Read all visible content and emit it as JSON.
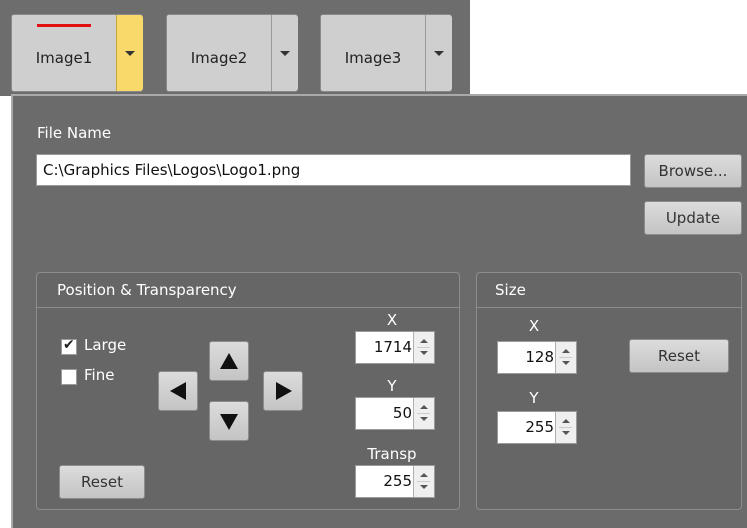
{
  "tabs": [
    {
      "label": "Image1",
      "active": true
    },
    {
      "label": "Image2",
      "active": false
    },
    {
      "label": "Image3",
      "active": false
    }
  ],
  "file": {
    "label": "File Name",
    "value": "C:\\Graphics Files\\Logos\\Logo1.png",
    "browse_label": "Browse...",
    "update_label": "Update"
  },
  "position": {
    "title": "Position & Transparency",
    "large_label": "Large",
    "large_checked": true,
    "fine_label": "Fine",
    "fine_checked": false,
    "x_label": "X",
    "x_value": "1714",
    "y_label": "Y",
    "y_value": "50",
    "transp_label": "Transp",
    "transp_value": "255",
    "reset_label": "Reset"
  },
  "size": {
    "title": "Size",
    "x_label": "X",
    "x_value": "128",
    "y_label": "Y",
    "y_value": "255",
    "reset_label": "Reset"
  },
  "colors": {
    "panel_bg": "#6b6b6b",
    "active_dropdown": "#f8d96a",
    "active_indicator": "#e01010"
  }
}
